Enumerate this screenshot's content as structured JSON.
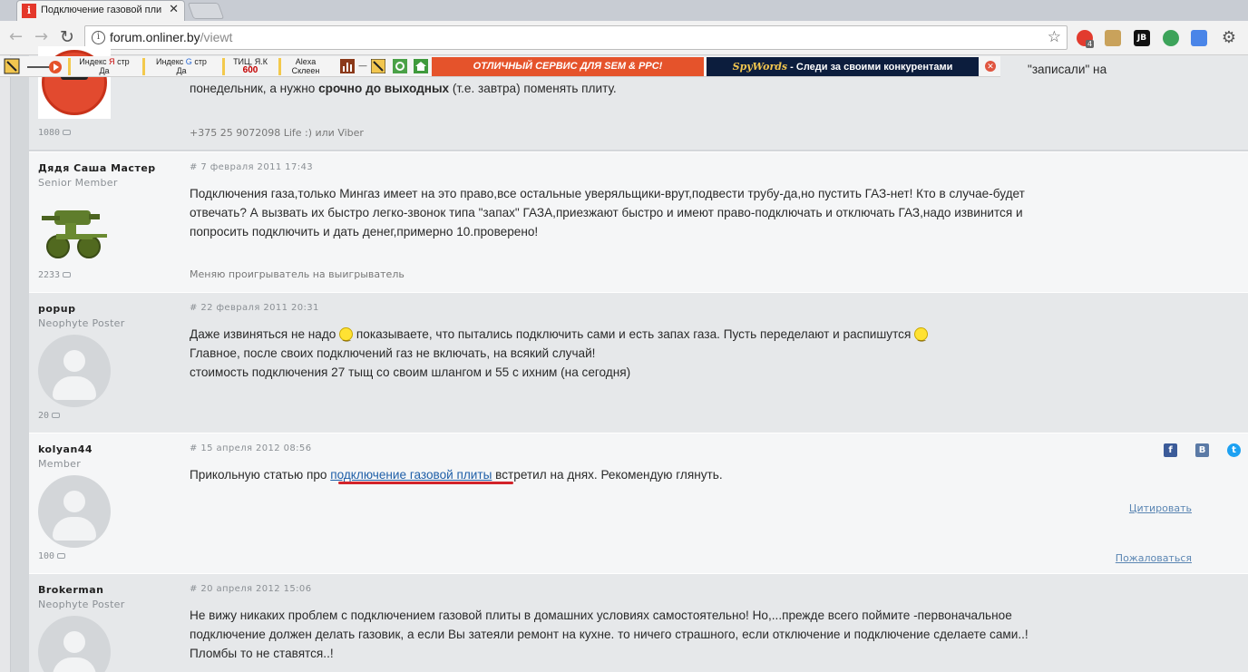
{
  "browser": {
    "tab_title": "Подключение газовой пли",
    "tab_favicon": "i",
    "url_domain": "forum.onliner.by",
    "url_path": "/viewt",
    "ext_badge_count": "4",
    "ext_jb": "JB"
  },
  "seo_toolbar": {
    "yandex_index_label": "Индекс",
    "yandex_letter": "Я",
    "yandex_pages": "стр",
    "yandex_value": "Да",
    "google_index_label": "Индекс",
    "google_letter": "G",
    "google_pages": "стр",
    "google_value": "Да",
    "tic_label": "ТИЦ, Я.К",
    "tic_value": "600",
    "alexa_label": "Alexa",
    "alexa_value": "Склеен",
    "banner1_text": "ОТЛИЧНЫЙ СЕРВИС ДЛЯ SEM & PPC!",
    "banner2_logo": "SpyWords",
    "banner2_text": " - Следи за своими конкурентами",
    "accent_orange": "#e5532b",
    "accent_navy": "#0c1d3d"
  },
  "posts": [
    {
      "post_count": "1080",
      "text_overflow_right": "\"записали\" на",
      "text_line_prefix": "понедельник, а нужно ",
      "text_bold": "срочно до выходных",
      "text_line_suffix": " (т.е. завтра) поменять плиту.",
      "signature": "+375 25 9072098 Life :) или Viber"
    },
    {
      "author": "Дядя Саша Мастер",
      "role": "Senior Member",
      "date": "# 7 февраля 2011 17:43",
      "text_1": "Подключения газа,только Мингаз имеет на это право,все остальные уверяльщики-врут,подвести трубу-да,но пустить ГАЗ-нет! Кто в случае-будет",
      "text_2": "отвечать? А вызвать их быстро легко-звонок типа \"запах\" ГАЗА,приезжают быстро и имеют право-подключать и отключать ГАЗ,надо извинится и",
      "text_3": "попросить подключить и дать денег,примерно 10.проверено!",
      "post_count": "2233",
      "signature": "Меняю проигрыватель на выигрыватель"
    },
    {
      "author": "popup",
      "role": "Neophyte Poster",
      "date": "# 22 февраля 2011 20:31",
      "text_1a": "Даже извиняться не надо ",
      "text_1b": " показываете, что пытались подключить сами и есть запах газа. Пусть переделают и распишутся ",
      "text_2": "Главное, после своих подключений газ не включать, на всякий случай!",
      "text_3": "стоимость подключения 27 тыщ со своим шлангом и 55 с ихним (на сегодня)",
      "post_count": "20"
    },
    {
      "author": "kolyan44",
      "role": "Member",
      "date": "# 15 апреля 2012 08:56",
      "text_prefix": "Прикольную статью про ",
      "text_link": "подключение газовой плиты",
      "text_suffix": " встретил на днях. Рекомендую глянуть.",
      "post_count": "100",
      "quote_label": "Цитировать",
      "report_label": "Пожаловаться",
      "share_fb": "f",
      "share_vk": "B",
      "share_tw": "t",
      "link_color": "#1f5fa8",
      "underline_color": "#d2232a"
    },
    {
      "author": "Brokerman",
      "role": "Neophyte Poster",
      "date": "# 20 апреля 2012 15:06",
      "text_1": "Не вижу никаких проблем с подключением газовой плиты в домашних условиях самостоятельно! Но,...прежде всего поймите -первоначальное",
      "text_2": "подключение должен делать газовик, а если Вы затеяли ремонт на кухне. то ничего страшного, если отключение и подключение сделаете сами..!",
      "text_3": "Пломбы то не ставятся..!"
    }
  ]
}
